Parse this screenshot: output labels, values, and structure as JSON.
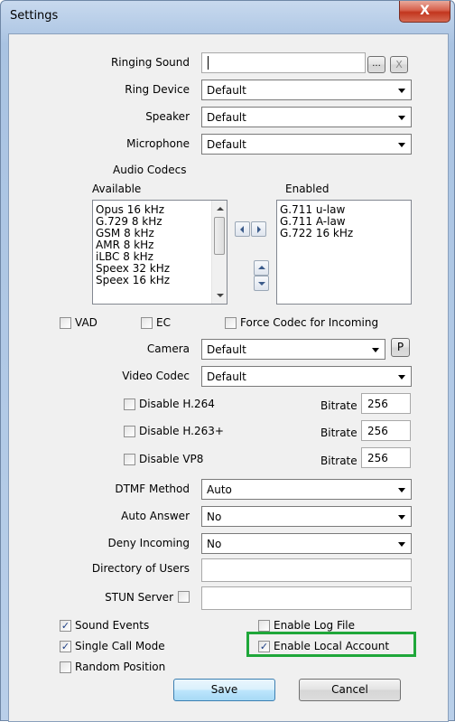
{
  "window": {
    "title": "Settings",
    "close_glyph": "X"
  },
  "ringing_sound": {
    "label": "Ringing Sound",
    "value": "",
    "browse_label": "...",
    "clear_label": "X"
  },
  "ring_device": {
    "label": "Ring Device",
    "value": "Default"
  },
  "speaker": {
    "label": "Speaker",
    "value": "Default"
  },
  "microphone": {
    "label": "Microphone",
    "value": "Default"
  },
  "audio_codecs": {
    "title": "Audio Codecs",
    "available_label": "Available",
    "enabled_label": "Enabled",
    "available": [
      "Opus 16 kHz",
      "G.729 8 kHz",
      "GSM 8 kHz",
      "AMR 8 kHz",
      "iLBC 8 kHz",
      "Speex 32 kHz",
      "Speex 16 kHz"
    ],
    "enabled": [
      "G.711 u-law",
      "G.711 A-law",
      "G.722 16 kHz"
    ]
  },
  "options": {
    "vad": "VAD",
    "ec": "EC",
    "force_codec": "Force Codec for Incoming"
  },
  "camera": {
    "label": "Camera",
    "value": "Default",
    "button": "P"
  },
  "video_codec": {
    "label": "Video Codec",
    "value": "Default"
  },
  "video": {
    "h264": {
      "label": "Disable H.264",
      "bitrate_label": "Bitrate",
      "bitrate": "256"
    },
    "h263": {
      "label": "Disable H.263+",
      "bitrate_label": "Bitrate",
      "bitrate": "256"
    },
    "vp8": {
      "label": "Disable VP8",
      "bitrate_label": "Bitrate",
      "bitrate": "256"
    }
  },
  "dtmf": {
    "label": "DTMF Method",
    "value": "Auto"
  },
  "auto_answer": {
    "label": "Auto Answer",
    "value": "No"
  },
  "deny_incoming": {
    "label": "Deny Incoming",
    "value": "No"
  },
  "directory": {
    "label": "Directory of Users",
    "value": ""
  },
  "stun": {
    "label": "STUN Server",
    "value": ""
  },
  "checks": {
    "sound_events": "Sound Events",
    "single_call": "Single Call Mode",
    "random_position": "Random Position",
    "enable_log": "Enable Log File",
    "enable_local": "Enable Local Account",
    "check_glyph": "✓"
  },
  "buttons": {
    "save": "Save",
    "cancel": "Cancel"
  }
}
